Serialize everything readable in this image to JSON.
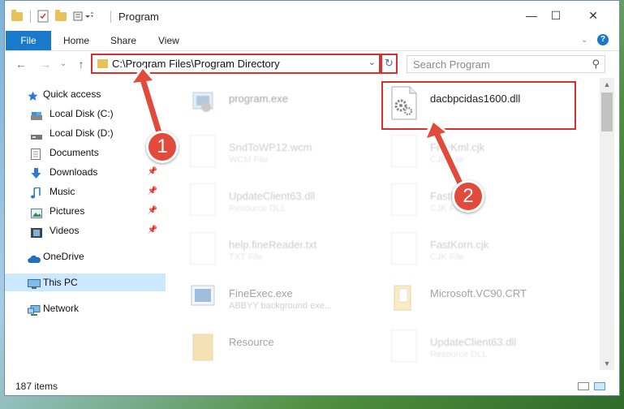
{
  "window": {
    "title": "Program"
  },
  "ribbon": {
    "tabs": [
      "File",
      "Home",
      "Share",
      "View"
    ]
  },
  "address": {
    "path": "C:\\Program Files\\Program Directory",
    "search_placeholder": "Search Program"
  },
  "sidebar": {
    "items": [
      {
        "label": "Quick access",
        "icon": "star-icon",
        "pinned": false
      },
      {
        "label": "Local Disk (C:)",
        "icon": "drive-icon",
        "pinned": false
      },
      {
        "label": "Local Disk (D:)",
        "icon": "drive-icon",
        "pinned": false
      },
      {
        "label": "Documents",
        "icon": "documents-icon",
        "pinned": false
      },
      {
        "label": "Downloads",
        "icon": "download-icon",
        "pinned": true
      },
      {
        "label": "Music",
        "icon": "music-icon",
        "pinned": true
      },
      {
        "label": "Pictures",
        "icon": "pictures-icon",
        "pinned": true
      },
      {
        "label": "Videos",
        "icon": "videos-icon",
        "pinned": true
      },
      {
        "label": "OneDrive",
        "icon": "cloud-icon",
        "pinned": false
      },
      {
        "label": "This PC",
        "icon": "computer-icon",
        "pinned": false
      },
      {
        "label": "Network",
        "icon": "network-icon",
        "pinned": false
      }
    ]
  },
  "files": [
    {
      "name": "program.exe",
      "type": ""
    },
    {
      "name": "dacbpcidas1600.dll",
      "type": ""
    },
    {
      "name": "SndToWP12.wcm",
      "type": "WCM File"
    },
    {
      "name": "FineKml.cjk",
      "type": "CJK File"
    },
    {
      "name": "UpdateClient63.dll",
      "type": "Resource DLL"
    },
    {
      "name": "FastNe.cjk",
      "type": "CJK File"
    },
    {
      "name": "help.fineReader.txt",
      "type": "TXT File"
    },
    {
      "name": "FastKorn.cjk",
      "type": "CJK File"
    },
    {
      "name": "FineExec.exe",
      "type": "ABBYY background exe..."
    },
    {
      "name": "Microsoft.VC90.CRT",
      "type": ""
    },
    {
      "name": "Resource",
      "type": ""
    },
    {
      "name": "UpdateClient63.dll",
      "type": "Resource DLL"
    }
  ],
  "status": {
    "item_count": "187 items"
  },
  "annotations": {
    "badge1": "1",
    "badge2": "2"
  },
  "colors": {
    "accent": "#1979ca",
    "highlight": "#d9302d",
    "selected": "#cce8ff"
  }
}
